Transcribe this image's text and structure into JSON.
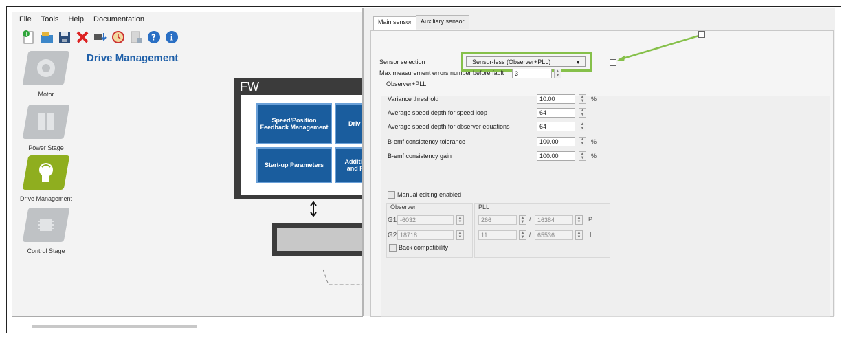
{
  "menu": [
    "File",
    "Tools",
    "Help",
    "Documentation"
  ],
  "toolbar_icons": [
    "new-icon",
    "open-icon",
    "save-icon",
    "delete-icon",
    "download-chip-icon",
    "clock-icon",
    "export-icon",
    "help-icon",
    "info-icon"
  ],
  "nav": [
    {
      "label": "Motor",
      "icon": "motor-icon"
    },
    {
      "label": "Power Stage",
      "icon": "power-stage-icon"
    },
    {
      "label": "Drive Management",
      "icon": "drive-management-icon",
      "active": true
    },
    {
      "label": "Control Stage",
      "icon": "control-stage-icon"
    }
  ],
  "page_title": "Drive Management",
  "fw": {
    "label": "FW",
    "blocks": [
      "Speed/Position Feedback Management",
      "Driv",
      "Start-up Parameters",
      "Additio and P"
    ]
  },
  "dialog": {
    "tabs": [
      "Main sensor",
      "Auxiliary sensor"
    ],
    "sensor_selection_label": "Sensor selection",
    "sensor_selection_value": "Sensor-less (Observer+PLL)",
    "max_errors_label": "Max measurement errors number before fault",
    "max_errors_value": "3",
    "group_title": "Observer+PLL",
    "params": [
      {
        "label": "Variance threshold",
        "value": "10.00",
        "unit": "%"
      },
      {
        "label": "Average speed depth for speed loop",
        "value": "64",
        "unit": ""
      },
      {
        "label": "Average speed depth for observer equations",
        "value": "64",
        "unit": ""
      },
      {
        "label": "B-emf consistency tolerance",
        "value": "100.00",
        "unit": "%"
      },
      {
        "label": "B-emf consistency gain",
        "value": "100.00",
        "unit": "%"
      }
    ],
    "manual_editing_label": "Manual editing enabled",
    "observer_title": "Observer",
    "pll_title": "PLL",
    "g1_label": "G1",
    "g1_value": "-6032",
    "g2_label": "G2",
    "g2_value": "18718",
    "pll_p_num": "266",
    "pll_p_den": "16384",
    "pll_i_num": "11",
    "pll_i_den": "65536",
    "slash": "/",
    "p_label": "P",
    "i_label": "I",
    "back_compat_label": "Back compatibility"
  },
  "colors": {
    "highlight": "#86c04a",
    "fw_block": "#1a5d9e",
    "title": "#1e5fa8",
    "nav_active": "#8fae1f"
  }
}
